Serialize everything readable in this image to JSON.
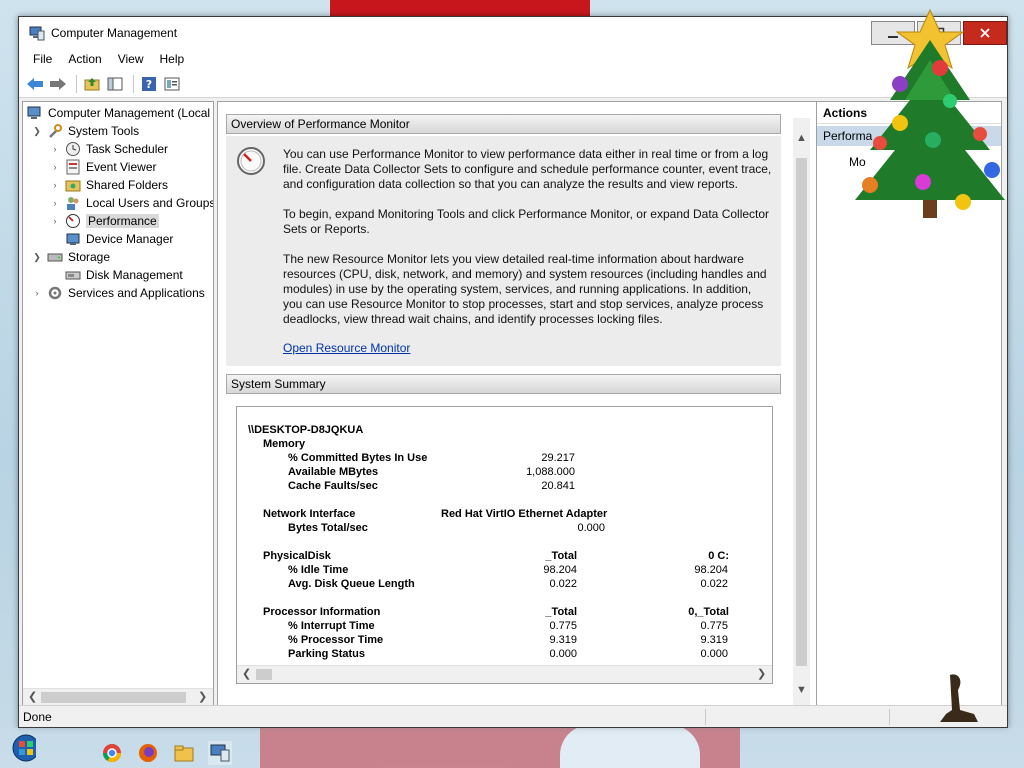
{
  "window": {
    "title": "Computer Management"
  },
  "menu": [
    "File",
    "Action",
    "View",
    "Help"
  ],
  "tree": {
    "items": [
      {
        "label": "Computer Management (Local",
        "level": 0,
        "expander": ""
      },
      {
        "label": "System Tools",
        "level": 1,
        "expander": "down"
      },
      {
        "label": "Task Scheduler",
        "level": 2,
        "expander": "right"
      },
      {
        "label": "Event Viewer",
        "level": 2,
        "expander": "right"
      },
      {
        "label": "Shared Folders",
        "level": 2,
        "expander": "right"
      },
      {
        "label": "Local Users and Groups",
        "level": 2,
        "expander": "right"
      },
      {
        "label": "Performance",
        "level": 2,
        "expander": "right",
        "selected": true
      },
      {
        "label": "Device Manager",
        "level": 2,
        "expander": ""
      },
      {
        "label": "Storage",
        "level": 1,
        "expander": "down"
      },
      {
        "label": "Disk Management",
        "level": 2,
        "expander": ""
      },
      {
        "label": "Services and Applications",
        "level": 1,
        "expander": "right"
      }
    ]
  },
  "overview": {
    "header": "Overview of Performance Monitor",
    "p1": "You can use Performance Monitor to view performance data either in real time or from a log file. Create Data Collector Sets to configure and schedule performance counter, event trace, and configuration data collection so that you can analyze the results and view reports.",
    "p2": "To begin, expand Monitoring Tools and click Performance Monitor, or expand Data Collector Sets or Reports.",
    "p3": "The new Resource Monitor lets you view detailed real-time information about hardware resources (CPU, disk, network, and memory) and system resources (including handles and modules) in use by the operating system, services, and running applications. In addition, you can use Resource Monitor to stop processes, start and stop services, analyze process deadlocks, view thread wait chains, and identify processes locking files.",
    "link": "Open Resource Monitor"
  },
  "summary": {
    "header": "System Summary",
    "machine": "\\\\DESKTOP-D8JQKUA",
    "memory": {
      "label": "Memory",
      "rows": [
        {
          "name": "% Committed Bytes In Use",
          "value": "29.217"
        },
        {
          "name": "Available MBytes",
          "value": "1,088.000"
        },
        {
          "name": "Cache Faults/sec",
          "value": "20.841"
        }
      ]
    },
    "network": {
      "label": "Network Interface",
      "adapter": "Red Hat VirtIO Ethernet Adapter",
      "rows": [
        {
          "name": "Bytes Total/sec",
          "value": "0.000"
        }
      ]
    },
    "disk": {
      "label": "PhysicalDisk",
      "col1": "_Total",
      "col2": "0 C:",
      "rows": [
        {
          "name": "% Idle Time",
          "v1": "98.204",
          "v2": "98.204"
        },
        {
          "name": "Avg. Disk Queue Length",
          "v1": "0.022",
          "v2": "0.022"
        }
      ]
    },
    "processor": {
      "label": "Processor Information",
      "col1": "_Total",
      "col2": "0,_Total",
      "rows": [
        {
          "name": "% Interrupt Time",
          "v1": "0.775",
          "v2": "0.775"
        },
        {
          "name": "% Processor Time",
          "v1": "9.319",
          "v2": "9.319"
        },
        {
          "name": "Parking Status",
          "v1": "0.000",
          "v2": "0.000"
        }
      ]
    }
  },
  "actions": {
    "header": "Actions",
    "selected": "Performa",
    "more": "Mo"
  },
  "status": {
    "text": "Done"
  },
  "colors": {
    "close": "#c42b1c",
    "link": "#0033aa",
    "selected_action": "#c9d9ea"
  }
}
